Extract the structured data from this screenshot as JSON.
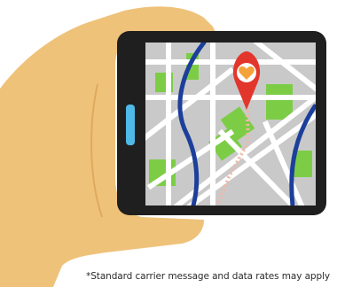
{
  "illustration": {
    "subject": "hand holding smartphone showing map with location pin",
    "icons": [
      "hand-icon",
      "smartphone-icon",
      "map-pin-icon",
      "heart-icon"
    ],
    "colors": {
      "skin": "#efc27a",
      "phone_body": "#1f1f1f",
      "phone_button": "#4fb9e8",
      "map_background": "#c9c9c9",
      "map_streets": "#ffffff",
      "map_parks": "#7ccd45",
      "map_rivers": "#1b3f9a",
      "route": "#f1b8a8",
      "pin": "#e2362c",
      "heart": "#f4a23a"
    }
  },
  "disclaimer": "*Standard carrier message and data rates may apply"
}
